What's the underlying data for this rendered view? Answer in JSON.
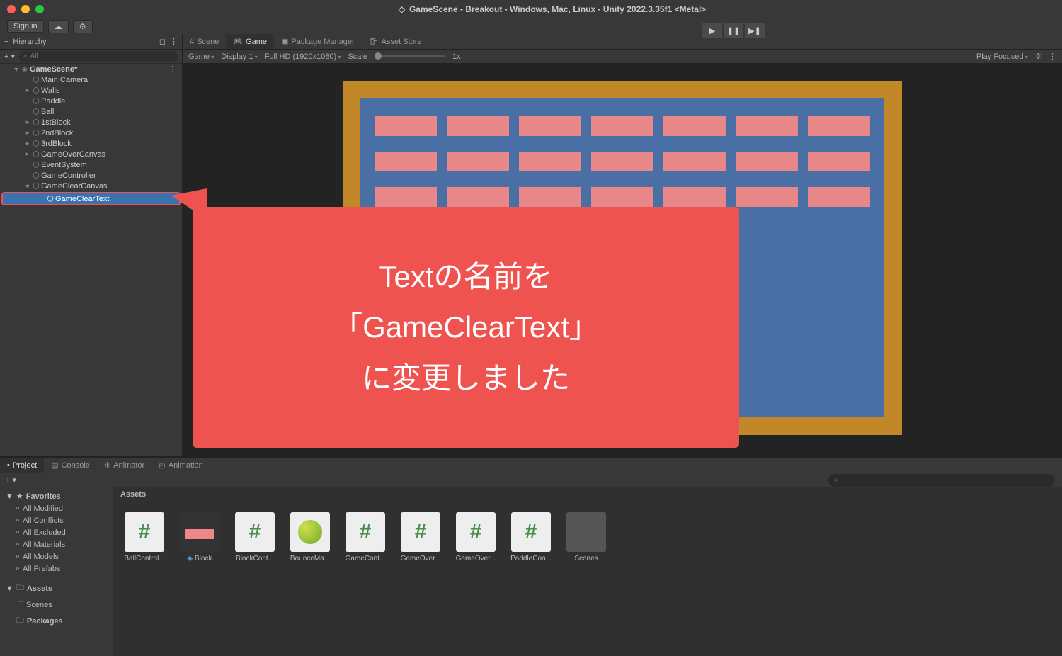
{
  "title": "GameScene - Breakout - Windows, Mac, Linux - Unity 2022.3.35f1 <Metal>",
  "toolbar": {
    "signin": "Sign in"
  },
  "hierarchy": {
    "title": "Hierarchy",
    "searchPlaceholder": "All",
    "scene": "GameScene*",
    "items": [
      "Main Camera",
      "Walls",
      "Paddle",
      "Ball",
      "1stBlock",
      "2ndBlock",
      "3rdBlock",
      "GameOverCanvas",
      "EventSystem",
      "GameController",
      "GameClearCanvas"
    ],
    "selected": "GameClearText"
  },
  "tabs": {
    "scene": "Scene",
    "game": "Game",
    "pkg": "Package Manager",
    "asset": "Asset Store"
  },
  "gamebar": {
    "mode": "Game",
    "display": "Display 1",
    "res": "Full HD (1920x1080)",
    "scale": "Scale",
    "scaleval": "1x",
    "play": "Play Focused"
  },
  "callout": {
    "l1": "Textの名前を",
    "l2": "「GameClearText」",
    "l3": "に変更しました"
  },
  "bottom": {
    "tabs": [
      "Project",
      "Console",
      "Animator",
      "Animation"
    ],
    "fav": "Favorites",
    "favs": [
      "All Modified",
      "All Conflicts",
      "All Excluded",
      "All Materials",
      "All Models",
      "All Prefabs"
    ],
    "tree": [
      "Assets",
      "Scenes",
      "Packages"
    ],
    "path": "Assets",
    "assets": [
      {
        "n": "BallControl...",
        "t": "cs"
      },
      {
        "n": "Block",
        "t": "prefab"
      },
      {
        "n": "BlockCont...",
        "t": "cs"
      },
      {
        "n": "BounceMa...",
        "t": "mat"
      },
      {
        "n": "GameCont...",
        "t": "cs"
      },
      {
        "n": "GameOver...",
        "t": "cs"
      },
      {
        "n": "GameOver...",
        "t": "cs"
      },
      {
        "n": "PaddleCon...",
        "t": "cs"
      },
      {
        "n": "Scenes",
        "t": "folder"
      }
    ]
  }
}
